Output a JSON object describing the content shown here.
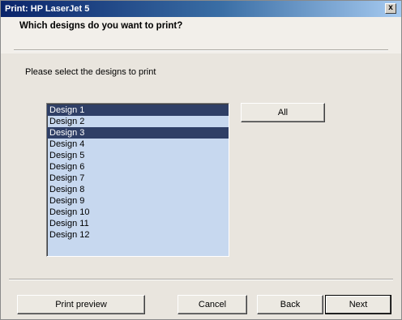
{
  "window": {
    "title": "Print: HP LaserJet 5",
    "close_glyph": "x"
  },
  "header": {
    "question": "Which designs do you want to print?"
  },
  "main": {
    "prompt": "Please select the designs to print",
    "all_button": "All",
    "designs": [
      {
        "label": "Design 1",
        "selected": true
      },
      {
        "label": "Design 2",
        "selected": false
      },
      {
        "label": "Design 3",
        "selected": true
      },
      {
        "label": "Design 4",
        "selected": false
      },
      {
        "label": "Design 5",
        "selected": false
      },
      {
        "label": "Design 6",
        "selected": false
      },
      {
        "label": "Design 7",
        "selected": false
      },
      {
        "label": "Design 8",
        "selected": false
      },
      {
        "label": "Design 9",
        "selected": false
      },
      {
        "label": "Design 10",
        "selected": false
      },
      {
        "label": "Design 11",
        "selected": false
      },
      {
        "label": "Design 12",
        "selected": false
      }
    ]
  },
  "footer": {
    "print_preview": "Print preview",
    "cancel": "Cancel",
    "back": "Back",
    "next": "Next"
  },
  "colors": {
    "selection": "#2f3f66",
    "list_background": "#c7d8ef",
    "title_bar": "#0a246a"
  }
}
